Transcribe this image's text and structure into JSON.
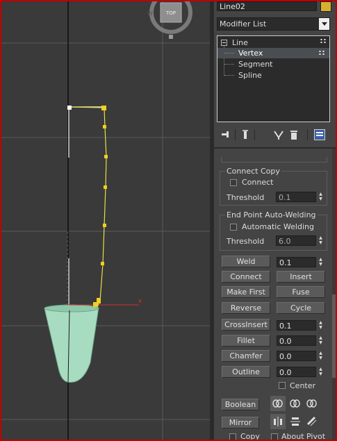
{
  "object_name": "Line02",
  "object_color": "#d8b030",
  "modifier_list_label": "Modifier List",
  "stack": {
    "root": "Line",
    "items": [
      {
        "label": "Vertex",
        "selected": true
      },
      {
        "label": "Segment",
        "selected": false
      },
      {
        "label": "Spline",
        "selected": false
      }
    ]
  },
  "viewcube_label": "TOP",
  "connect_copy": {
    "title": "Connect Copy",
    "connect_label": "Connect",
    "threshold_label": "Threshold",
    "threshold_value": "0.1"
  },
  "endpoint_welding": {
    "title": "End Point Auto-Welding",
    "auto_label": "Automatic Welding",
    "threshold_label": "Threshold",
    "threshold_value": "6.0"
  },
  "buttons": {
    "weld": "Weld",
    "weld_value": "0.1",
    "connect": "Connect",
    "insert": "Insert",
    "make_first": "Make First",
    "fuse": "Fuse",
    "reverse": "Reverse",
    "cycle": "Cycle",
    "crossinsert": "CrossInsert",
    "crossinsert_value": "0.1",
    "fillet": "Fillet",
    "fillet_value": "0.0",
    "chamfer": "Chamfer",
    "chamfer_value": "0.0",
    "outline": "Outline",
    "outline_value": "0.0",
    "center_label": "Center",
    "boolean": "Boolean",
    "mirror": "Mirror",
    "copy_label": "Copy",
    "about_pivot_label": "About Pivot"
  },
  "axis_x_label": "x",
  "colors": {
    "vertex": "#f0d020",
    "spline": "#e8e040",
    "cone": "#a8dcc0",
    "axis": "#d03030"
  }
}
